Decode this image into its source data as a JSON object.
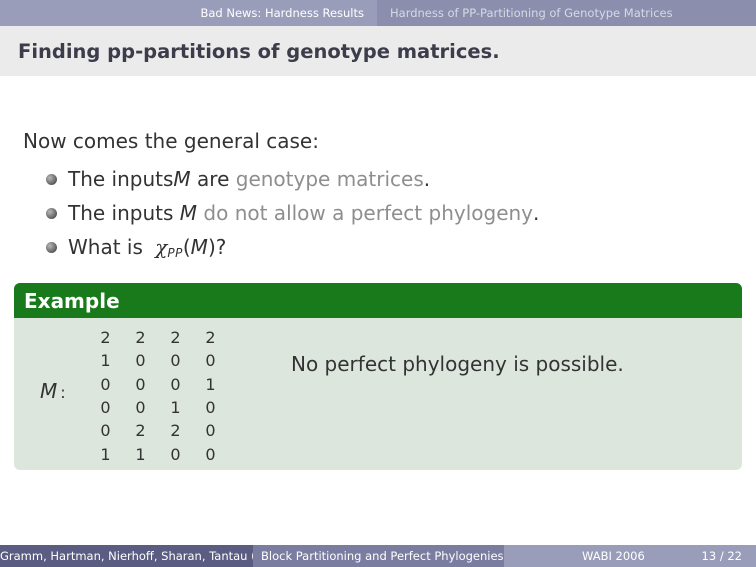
{
  "nav": {
    "left_section": "Bad News: Hardness Results",
    "right_section": "Hardness of PP-Partitioning of Genotype Matrices"
  },
  "frame": {
    "title": "Finding pp-partitions of genotype matrices."
  },
  "content": {
    "intro": "Now comes the general case:",
    "bullets": [
      {
        "prefix": "The inputs ",
        "var": "M",
        "mid": " are ",
        "grey": "genotype matrices",
        "suffix": "."
      },
      {
        "prefix": "The inputs ",
        "var": "M",
        "mid": " ",
        "grey": "do not allow a perfect phylogeny",
        "suffix": "."
      },
      {
        "prefix": "What is ",
        "chi": "χ",
        "chi_sub": "PP",
        "open": "(",
        "var": "M",
        "close": ")?"
      }
    ]
  },
  "example": {
    "header": "Example",
    "matrix_label": "M",
    "matrix_colon": ":",
    "matrix_rows": [
      [
        "2",
        "2",
        "2",
        "2"
      ],
      [
        "1",
        "0",
        "0",
        "0"
      ],
      [
        "0",
        "0",
        "0",
        "1"
      ],
      [
        "0",
        "0",
        "1",
        "0"
      ],
      [
        "0",
        "2",
        "2",
        "0"
      ],
      [
        "1",
        "1",
        "0",
        "0"
      ]
    ],
    "statement": "No perfect phylogeny is possible."
  },
  "footer": {
    "authors": "Gramm, Hartman, Nierhoff, Sharan, Tantau (T",
    "short_title": "Block Partitioning and Perfect Phylogenies",
    "venue": "WABI 2006",
    "page": "13 / 22"
  },
  "colors": {
    "nav_bar": "#9a9dba",
    "example_header": "#187a1b",
    "example_body": "#dde6dd",
    "footer_dark": "#5a5c82"
  }
}
